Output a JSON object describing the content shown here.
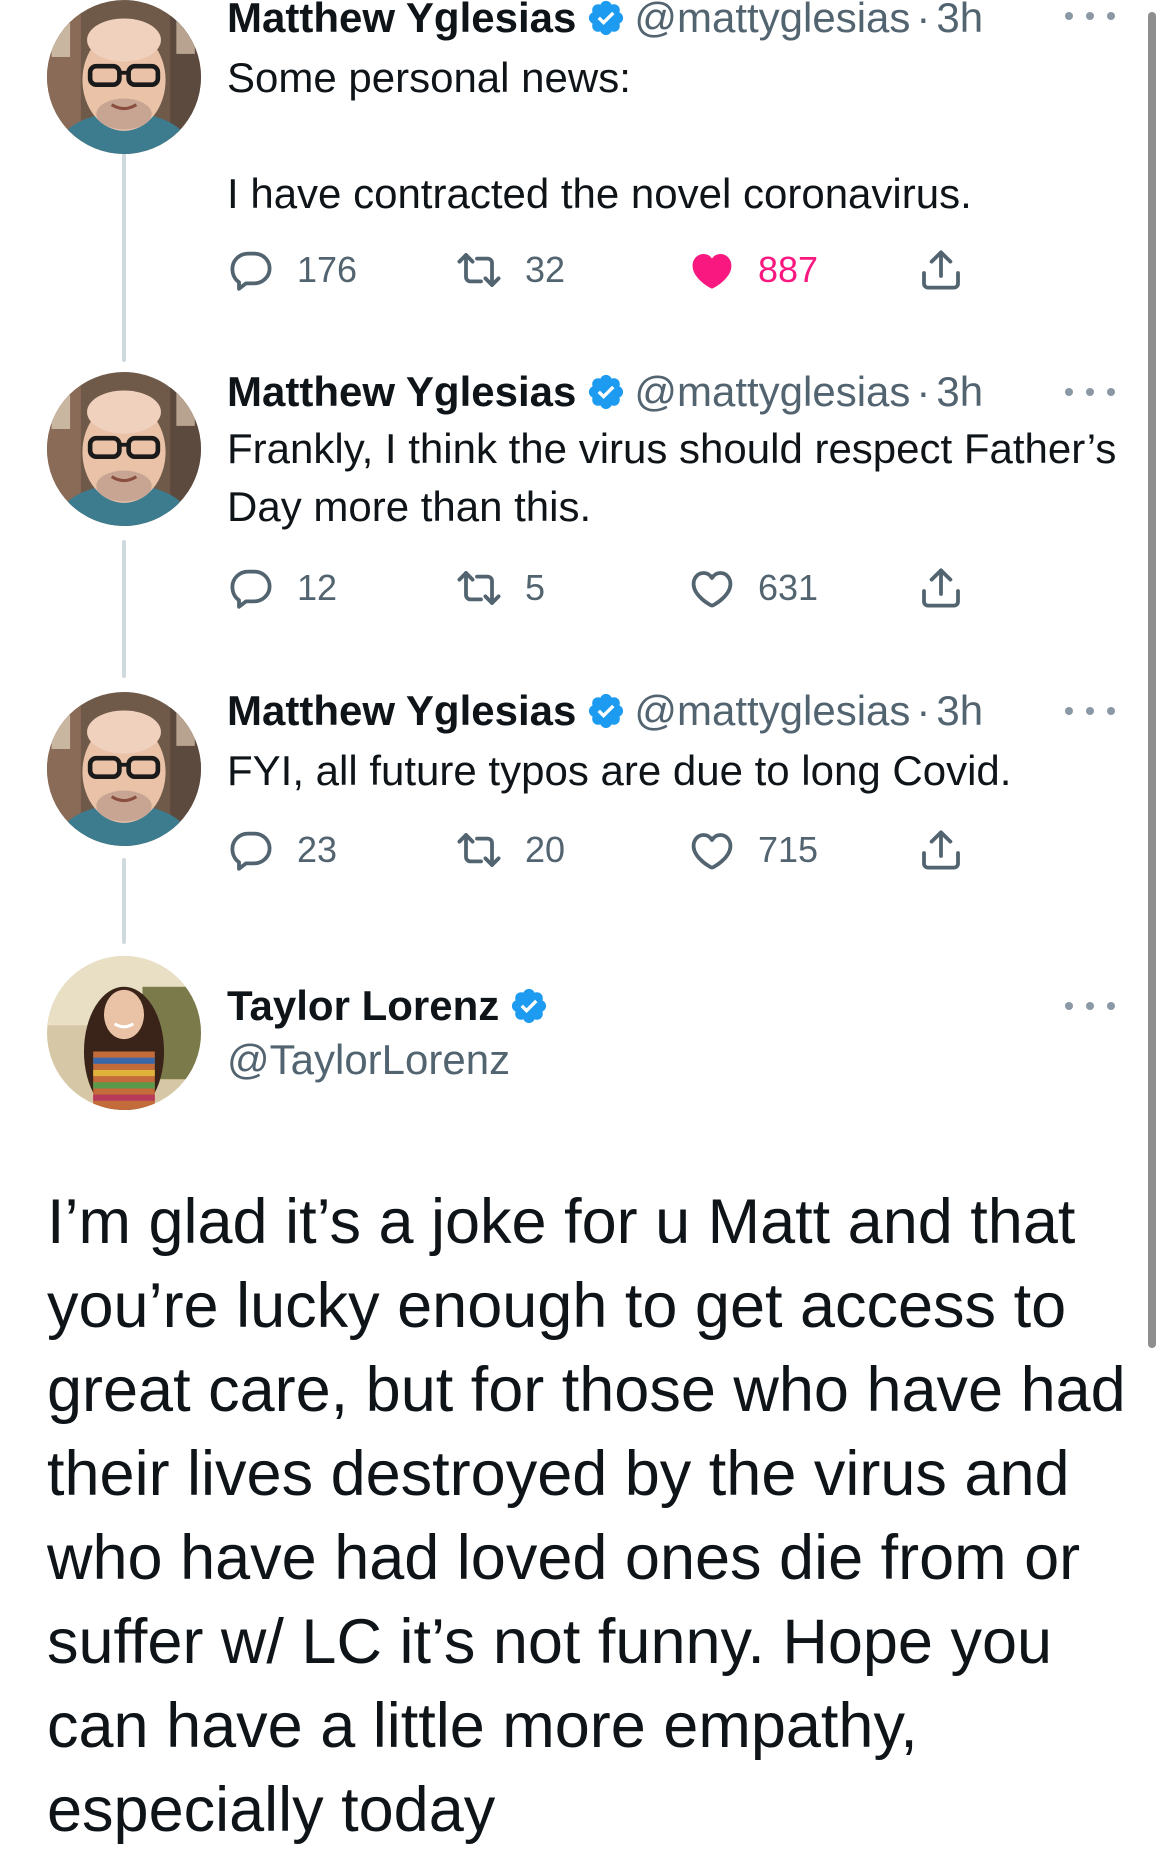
{
  "colors": {
    "accent": "#1d9bf0",
    "like": "#f91880",
    "muted": "#536471",
    "line": "#cfd9de"
  },
  "thread": [
    {
      "name": "Matthew Yglesias",
      "handle": "@mattyglesias",
      "separator": "·",
      "time": "3h",
      "text": "Some personal news:\n\nI have contracted the novel coronavirus.",
      "replies": "176",
      "retweets": "32",
      "likes": "887",
      "liked": true
    },
    {
      "name": "Matthew Yglesias",
      "handle": "@mattyglesias",
      "separator": "·",
      "time": "3h",
      "text": "Frankly, I think the virus should respect Father’s Day more than this.",
      "replies": "12",
      "retweets": "5",
      "likes": "631",
      "liked": false
    },
    {
      "name": "Matthew Yglesias",
      "handle": "@mattyglesias",
      "separator": "·",
      "time": "3h",
      "text": "FYI, all future typos are due to long Covid.",
      "replies": "23",
      "retweets": "20",
      "likes": "715",
      "liked": false
    }
  ],
  "reply": {
    "name": "Taylor Lorenz",
    "handle": "@TaylorLorenz",
    "text": "I’m glad it’s a joke for u Matt and that you’re lucky enough to get access to great care, but for those who have had their lives destroyed by the virus and who have had loved ones die from or suffer w/ LC it’s not funny. Hope you can have a little more empathy, especially today"
  },
  "icons": {
    "verified": "verified-badge-icon",
    "more": "more-dots-icon",
    "reply": "reply-bubble-icon",
    "retweet": "retweet-icon",
    "like": "heart-icon",
    "share": "share-icon"
  }
}
